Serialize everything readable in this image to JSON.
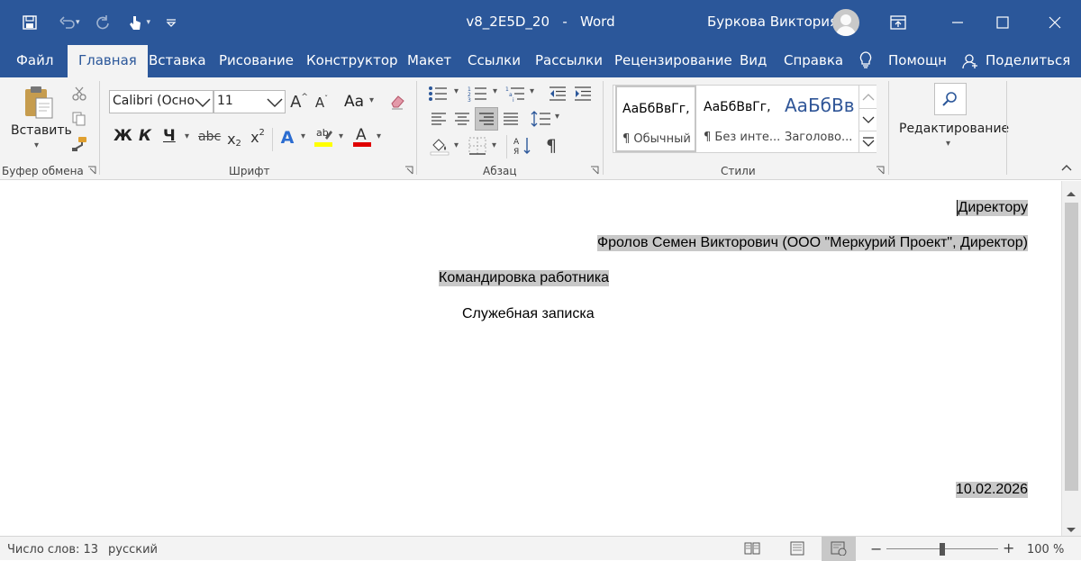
{
  "window": {
    "doc_name": "v8_2E5D_20",
    "separator": "-",
    "app_name": "Word",
    "user_name": "Буркова Виктория"
  },
  "tabs": [
    {
      "label": "Файл"
    },
    {
      "label": "Главная"
    },
    {
      "label": "Вставка"
    },
    {
      "label": "Рисование"
    },
    {
      "label": "Конструктор"
    },
    {
      "label": "Макет"
    },
    {
      "label": "Ссылки"
    },
    {
      "label": "Рассылки"
    },
    {
      "label": "Рецензирование"
    },
    {
      "label": "Вид"
    },
    {
      "label": "Справка"
    }
  ],
  "tell_me": "Помощн",
  "share": "Поделиться",
  "ribbon": {
    "clipboard": {
      "paste_label": "Вставить",
      "group_label": "Буфер обмена"
    },
    "font": {
      "name": "Calibri (Осно",
      "size": "11",
      "bold": "Ж",
      "italic": "К",
      "underline": "Ч",
      "strike": "abc",
      "change_case": "Aa",
      "group_label": "Шрифт",
      "highlight_color": "#ffff00",
      "font_color": "#e00000"
    },
    "paragraph": {
      "group_label": "Абзац"
    },
    "styles": {
      "items": [
        {
          "preview": "АаБбВвГг,",
          "name": "¶ Обычный"
        },
        {
          "preview": "АаБбВвГг,",
          "name": "¶ Без инте..."
        },
        {
          "preview": "АаБбВв",
          "name": "Заголово..."
        }
      ],
      "group_label": "Стили"
    },
    "editing": {
      "label": "Редактирование"
    }
  },
  "document": {
    "lines": [
      "Директору",
      "Фролов Семен Викторович (ООО \"Меркурий Проект\", Директор)",
      "Командировка работника",
      "Служебная записка",
      "10.02.2026"
    ]
  },
  "status": {
    "word_count": "Число слов: 13",
    "language": "русский",
    "zoom": "100 %",
    "zoom_level": 100
  },
  "colors": {
    "title_bar": "#2b579a",
    "ribbon": "#f3f3f3",
    "field_highlight": "#c8c8c8"
  }
}
